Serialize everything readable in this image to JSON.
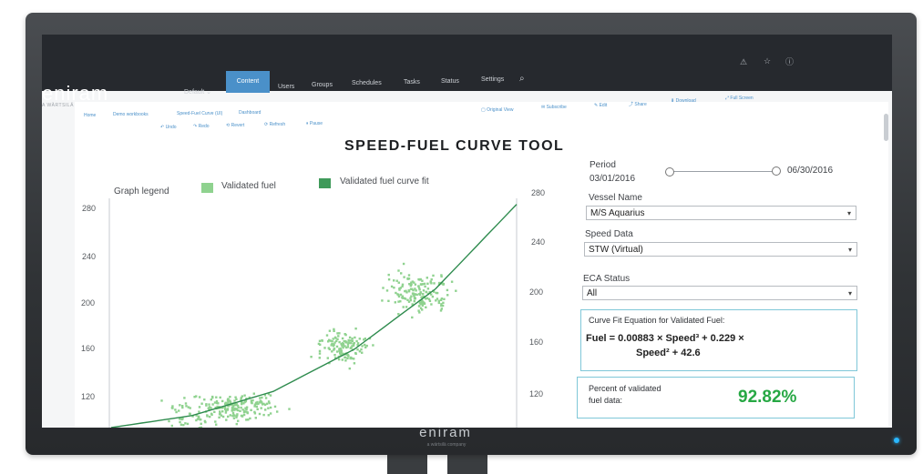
{
  "bezel": {
    "brand": "eniram",
    "sub": "a wärtsilä company"
  },
  "app": {
    "logo": "eniram",
    "logo_sub": "A WÄRTSILÄ COMPANY"
  },
  "nav": {
    "default_label": "Default ⌄",
    "items": [
      "Content",
      "Users",
      "Groups",
      "Schedules",
      "Tasks",
      "Status",
      "Settings"
    ],
    "active": "Content"
  },
  "top_icons": [
    "warning-icon",
    "star-icon",
    "help-icon"
  ],
  "breadcrumb": {
    "home": "Home",
    "crumb1": "Demo workbooks",
    "crumb2": "Speed-Fuel Curve (UI)",
    "crumb3": "Dashboard"
  },
  "toolbar_left": [
    "Undo",
    "Redo",
    "Revert",
    "Refresh",
    "Pause"
  ],
  "toolbar_right": [
    "Original View",
    "Subscribe",
    "Edit",
    "Share",
    "Download",
    "Full Screen"
  ],
  "page_title": "SPEED-FUEL CURVE TOOL",
  "legend": {
    "heading": "Graph legend",
    "items": [
      {
        "label": "Validated fuel",
        "color": "#8fd28f"
      },
      {
        "label": "Validated fuel curve fit",
        "color": "#3f9a5a"
      }
    ]
  },
  "chart_data": {
    "type": "scatter",
    "title": "",
    "xlabel": "",
    "ylabel": "",
    "ylim": [
      100,
      290
    ],
    "y_ticks_left": [
      280,
      240,
      200,
      160,
      120
    ],
    "y_ticks_right": [
      280,
      240,
      200,
      160,
      120
    ],
    "series": [
      {
        "name": "Validated fuel",
        "color": "#8fd28f",
        "clusters": [
          {
            "x_center": 0.32,
            "y_center": 118,
            "spread_x": 0.09,
            "spread_y": 9,
            "count": 180
          },
          {
            "x_center": 0.57,
            "y_center": 168,
            "spread_x": 0.06,
            "spread_y": 12,
            "count": 130
          },
          {
            "x_center": 0.76,
            "y_center": 212,
            "spread_x": 0.07,
            "spread_y": 15,
            "count": 170
          },
          {
            "x_center": 0.2,
            "y_center": 112,
            "spread_x": 0.07,
            "spread_y": 15,
            "count": 50
          }
        ]
      },
      {
        "name": "Validated fuel curve fit",
        "color": "#2e8b4e",
        "curve": [
          [
            0.0,
            100
          ],
          [
            0.2,
            110
          ],
          [
            0.4,
            130
          ],
          [
            0.6,
            165
          ],
          [
            0.8,
            215
          ],
          [
            1.0,
            285
          ]
        ]
      }
    ],
    "grid": false,
    "legend_position": "top"
  },
  "filters": {
    "period": {
      "label": "Period",
      "start": "03/01/2016",
      "end": "06/30/2016"
    },
    "vessel": {
      "label": "Vessel Name",
      "value": "M/S Aquarius"
    },
    "speed": {
      "label": "Speed Data",
      "value": "STW (Virtual)"
    },
    "eca": {
      "label": "ECA Status",
      "value": "All"
    }
  },
  "equation": {
    "title": "Curve Fit Equation for Validated Fuel:",
    "line1": "Fuel = 0.00883 × Speed³ + 0.229 ×",
    "line2": "Speed² + 42.6"
  },
  "percent": {
    "label_line1": "Percent of validated",
    "label_line2": "fuel data:",
    "value": "92.82%"
  },
  "colors": {
    "accent": "#4a90c9",
    "topbar": "#26292e",
    "scatter": "#8fd28f",
    "fit": "#2e8b4e",
    "percent": "#27a844",
    "box_border": "#7fc7d8"
  }
}
